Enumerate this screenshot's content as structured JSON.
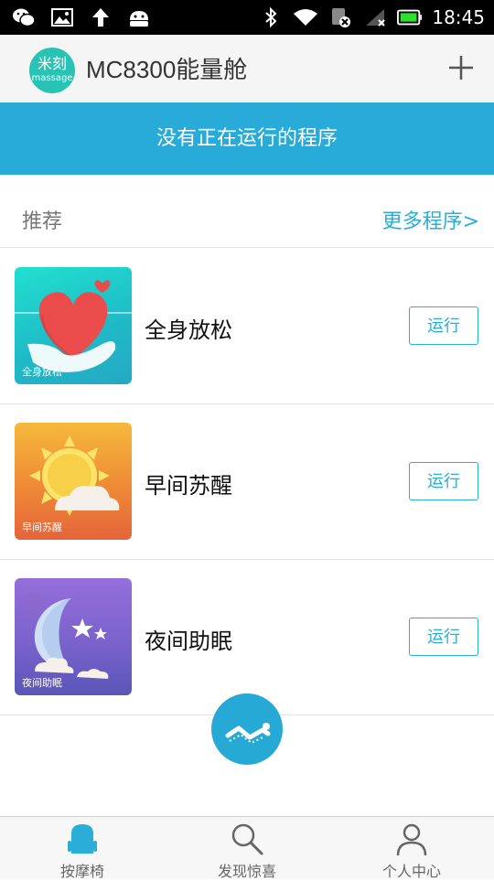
{
  "status_bar": {
    "time": "18:45",
    "left_icons": [
      "wechat-icon",
      "image-icon",
      "upload-arrow-icon",
      "android-icon"
    ],
    "right_icons": [
      "bluetooth-icon",
      "wifi-icon",
      "sim-icon",
      "signal-icon",
      "battery-icon"
    ]
  },
  "app_bar": {
    "logo_cn": "米刻",
    "logo_en": "massage",
    "title": "MC8300能量舱",
    "add_icon": "plus-icon"
  },
  "banner": {
    "text": "没有正在运行的程序"
  },
  "recommend": {
    "title": "推荐",
    "more_label": "更多程序>"
  },
  "programs": [
    {
      "name": "全身放松",
      "thumb_label": "全身放松",
      "run_label": "运行",
      "icon": "heart-hands-icon"
    },
    {
      "name": "早间苏醒",
      "thumb_label": "早间苏醒",
      "run_label": "运行",
      "icon": "sun-cloud-icon"
    },
    {
      "name": "夜间助眠",
      "thumb_label": "夜间助眠",
      "run_label": "运行",
      "icon": "moon-stars-icon"
    }
  ],
  "fab": {
    "icon": "massage-chair-icon"
  },
  "bottom_nav": [
    {
      "label": "按摩椅",
      "icon": "chair-icon",
      "active": true
    },
    {
      "label": "发现惊喜",
      "icon": "search-icon",
      "active": false
    },
    {
      "label": "个人中心",
      "icon": "person-icon",
      "active": false
    }
  ],
  "colors": {
    "accent": "#29abd9",
    "logo": "#28c3b5",
    "thumb1_top": "#1ed7c6",
    "thumb2_top": "#f5b33a",
    "thumb3_top": "#8e6bd1"
  }
}
